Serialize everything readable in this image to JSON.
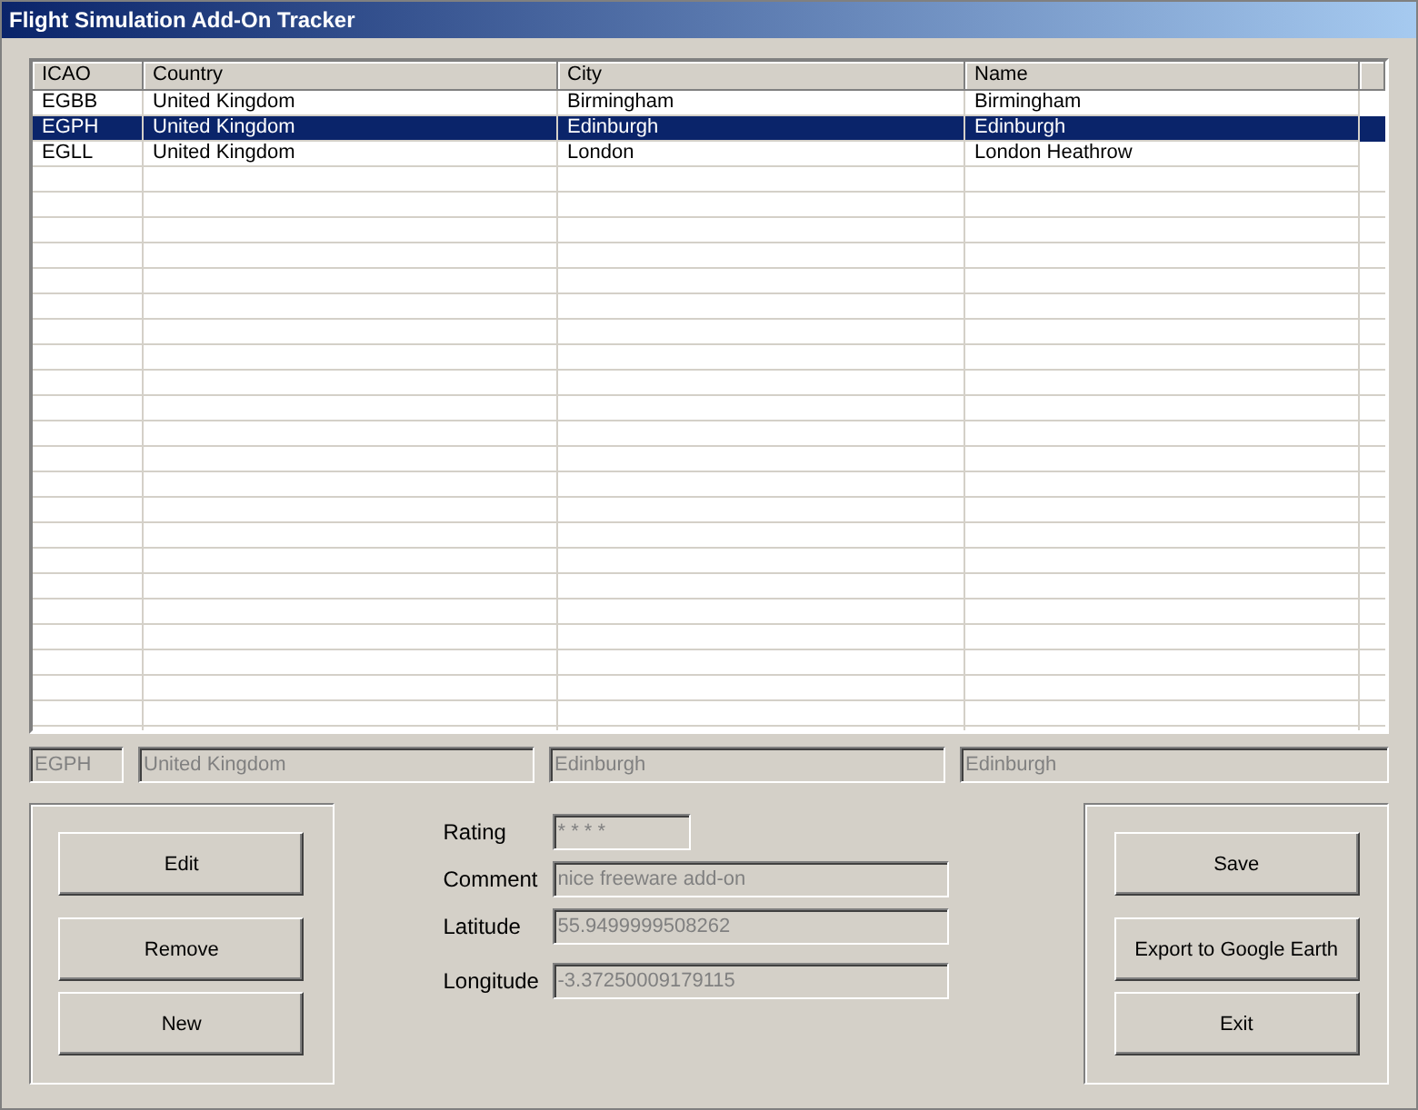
{
  "window": {
    "title": "Flight Simulation Add-On Tracker"
  },
  "table": {
    "columns": [
      "ICAO",
      "Country",
      "City",
      "Name"
    ],
    "rows": [
      {
        "cells": [
          "EGBB",
          "United Kingdom",
          "Birmingham",
          "Birmingham"
        ],
        "selected": false
      },
      {
        "cells": [
          "EGPH",
          "United Kingdom",
          "Edinburgh",
          "Edinburgh"
        ],
        "selected": true
      },
      {
        "cells": [
          "EGLL",
          "United Kingdom",
          "London",
          "London Heathrow"
        ],
        "selected": false
      }
    ]
  },
  "summary_fields": [
    {
      "value": "EGPH",
      "disabled": true
    },
    {
      "value": "United Kingdom",
      "disabled": true
    },
    {
      "value": "Edinburgh",
      "disabled": true
    },
    {
      "value": "Edinburgh",
      "disabled": true
    }
  ],
  "left_buttons": [
    "Edit",
    "Remove",
    "New"
  ],
  "details": [
    {
      "label": "Rating",
      "value": "* * * *",
      "disabled": true
    },
    {
      "label": "Comment",
      "value": "nice freeware add-on",
      "disabled": true
    },
    {
      "label": "Latitude",
      "value": "55.9499999508262",
      "disabled": true
    },
    {
      "label": "Longitude",
      "value": "-3.37250009179115",
      "disabled": true
    }
  ],
  "right_buttons": [
    "Save",
    "Export to Google Earth",
    "Exit"
  ]
}
